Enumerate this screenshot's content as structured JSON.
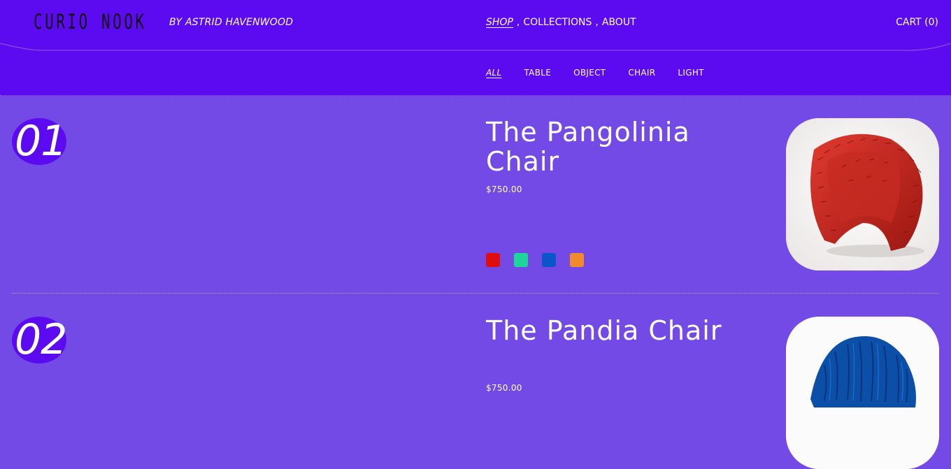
{
  "header": {
    "logo": "CURIO NOOK",
    "byline": "BY ASTRID HAVENWOOD",
    "nav": [
      {
        "label": "SHOP",
        "active": true
      },
      {
        "label": "COLLECTIONS",
        "active": false
      },
      {
        "label": "ABOUT",
        "active": false
      }
    ],
    "nav_separator": ",",
    "cart_label": "CART (0)"
  },
  "filters": [
    {
      "label": "ALL",
      "active": true
    },
    {
      "label": "TABLE",
      "active": false
    },
    {
      "label": "OBJECT",
      "active": false
    },
    {
      "label": "CHAIR",
      "active": false
    },
    {
      "label": "LIGHT",
      "active": false
    }
  ],
  "products": [
    {
      "number": "01",
      "title": "The Pangolinia Chair",
      "price": "$750.00",
      "swatches": [
        "#e00d0d",
        "#1ed69a",
        "#0a56c9",
        "#f28a2e"
      ],
      "image_icon": "red-scaled-chair-photo"
    },
    {
      "number": "02",
      "title": "The Pandia Chair",
      "price": "$750.00",
      "image_icon": "blue-fur-chair-photo"
    }
  ],
  "colors": {
    "page_bg": "#734ae6",
    "header_bg": "#5c0aef",
    "text": "#ffffff",
    "logo_text": "#111111"
  }
}
